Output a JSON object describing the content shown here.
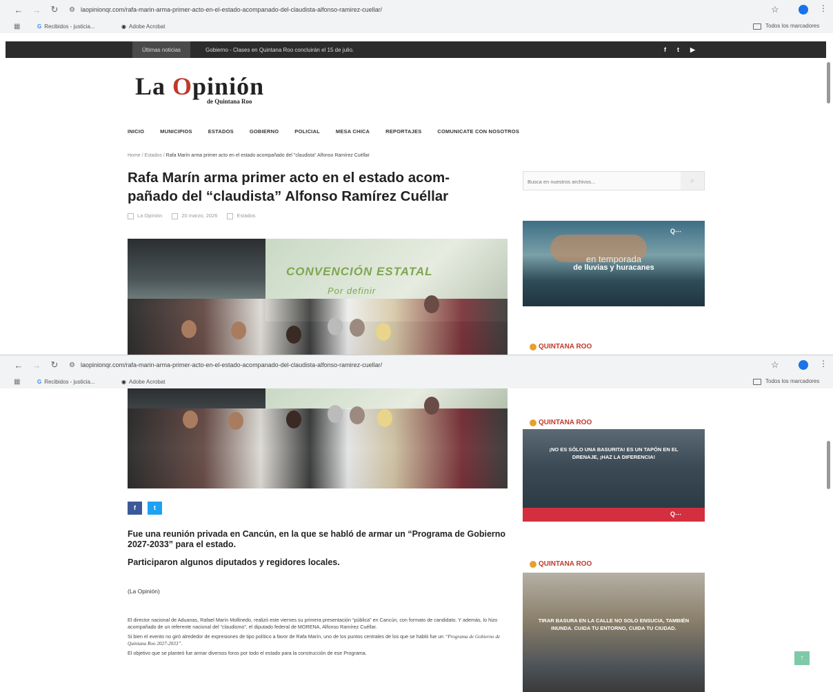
{
  "browser": {
    "url": "laopinionqr.com/rafa-marin-arma-primer-acto-en-el-estado-acompanado-del-claudista-alfonso-ramirez-cuellar/",
    "bookmarks": [
      "Recibidos - justicia...",
      "Adobe Acrobat"
    ],
    "all_bookmarks": "Todos los marcadores"
  },
  "topbar": {
    "tag": "Últimas noticias",
    "ticker": "Gobierno - Clases en Quintana Roo concluirán el 15 de julio.",
    "social": [
      "f",
      "t",
      "▶"
    ]
  },
  "site": {
    "logo_la": "La ",
    "logo_o": "O",
    "logo_rest": "pinión",
    "logo_sub": "de Quintana Roo"
  },
  "nav": [
    "INICIO",
    "MUNICIPIOS",
    "ESTADOS",
    "GOBIERNO",
    "POLICIAL",
    "MESA CHICA",
    "REPORTAJES",
    "COMUNICATE CON NOSOTROS"
  ],
  "breadcrumb": {
    "home": "Home",
    "section": "Estados",
    "current": "Rafa Marín arma primer acto en el estado acompañado del \"claudista\" Alfonso Ramírez Cuéllar"
  },
  "article": {
    "title_line1": "Rafa Marín arma primer acto en el estado acom-",
    "title_line2": "pañado del “claudista” Alfonso Ramírez Cuéllar",
    "author": "La Opinión",
    "date": "20 marzo, 2026",
    "category": "Estados",
    "lead": "Fue una reunión privada en Cancún, en la que se habló de armar un “Programa de Gobierno 2027-2033” para el estado.",
    "lead2": "Participaron algunos diputados y regidores locales.",
    "source": "(La Opinión)",
    "p1": "El director nacional de Aduanas, Rafael Marín Mollinedo, realizó este viernes su primera presentación “pública” en Cancún, con formato de candidato. Y además, lo hizo acompañado de un referente nacional del “claudismo”, el diputado federal de MORENA, Alfonso Ramírez Cuéllar.",
    "p2_a": "Si bien el evento no giró alrededor de expresiones de tipo político a favor de Rafa Marín, uno de los puntos centrales de los que se habló fue un ",
    "p2_em": "“Programa de Gobierno de Quintana Roo 2027-2033”",
    "p2_b": ".",
    "p3": "El objetivo que se planteó fue armar diversos foros por todo el estado para la construcción de ese Programa."
  },
  "photo": {
    "screen_text1": "CONVENCIÓN ESTATAL",
    "screen_text2": "Por definir"
  },
  "sidebar": {
    "search_placeholder": "Busca en nuestros archivos...",
    "ad1_line1": "en temporada",
    "ad1_line2": "de lluvias y huracanes",
    "brand": "QUINTANA ROO",
    "ad2_text": "¡NO ES SÓLO UNA BASURITA! ES UN TAPÓN EN EL DRENAJE, ¡HAZ LA DIFERENCIA!",
    "ad3_text": "TIRAR BASURA EN LA CALLE NO SOLO ENSUCIA, TAMBIÉN INUNDA. CUIDA TU ENTORNO, CUIDA TU CIUDAD."
  },
  "colors": {
    "logo_accent": "#c0392b",
    "facebook": "#3b5998",
    "twitter": "#1da1f2",
    "ad_red": "#d32f3f",
    "totop": "#7ec9a8"
  }
}
